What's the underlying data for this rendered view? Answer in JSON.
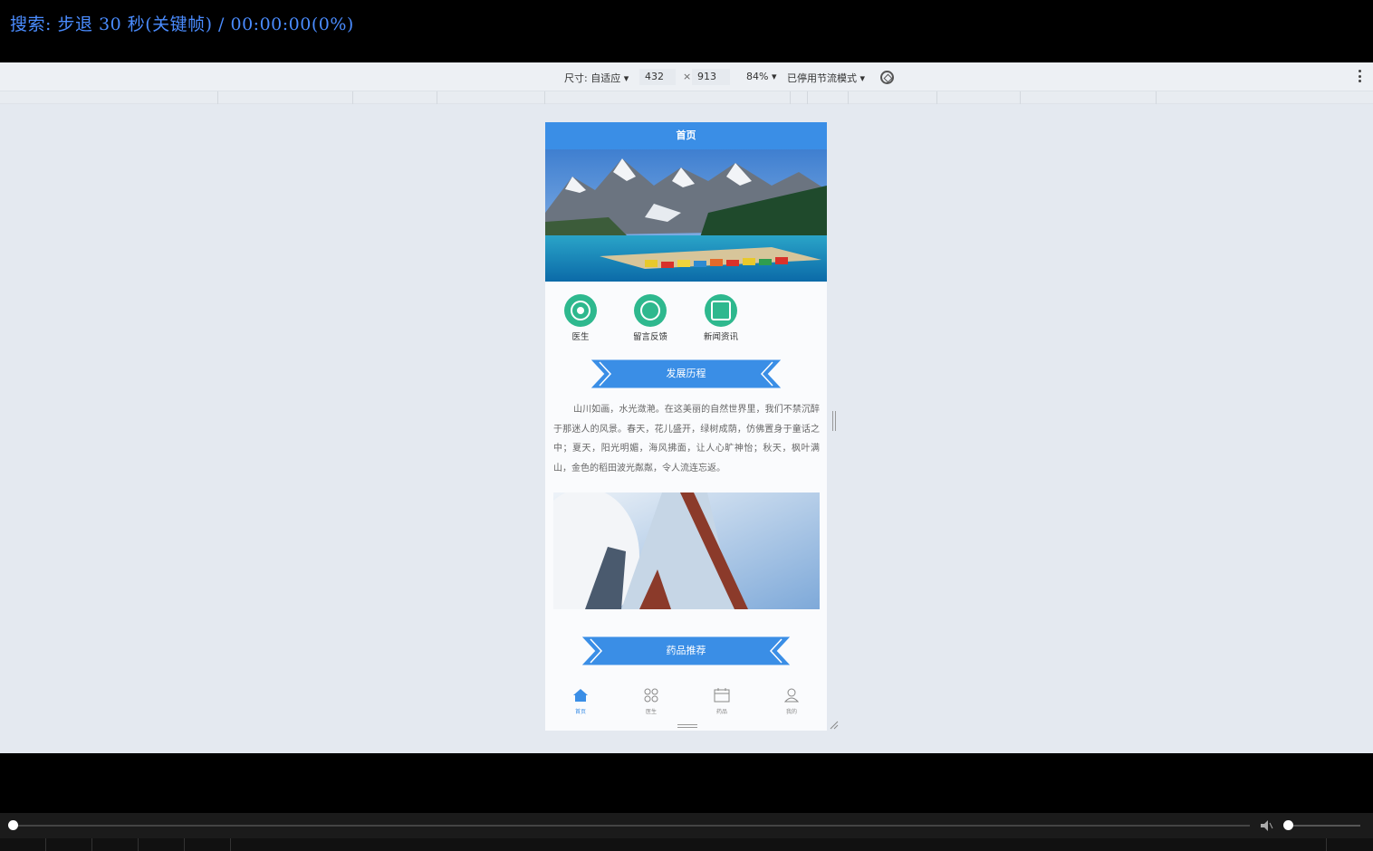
{
  "player": {
    "osd_text": "搜索: 步退 30 秒(关键帧) / 00:00:00(0%)"
  },
  "device_toolbar": {
    "size_label": "尺寸: 自适应 ▾",
    "width": "432",
    "times": "×",
    "height": "913",
    "zoom": "84% ▾",
    "throttle": "已停用节流模式 ▾",
    "rotate_icon": "rotate-icon",
    "more_icon": "more-vertical-icon"
  },
  "app": {
    "title": "首页",
    "banner_image": "mountain-lake-photo",
    "nav_items": [
      {
        "label": "医生",
        "icon": "doctor-icon"
      },
      {
        "label": "留言反馈",
        "icon": "feedback-icon"
      },
      {
        "label": "新闻资讯",
        "icon": "news-icon"
      }
    ],
    "section_history": "发展历程",
    "history_text": "山川如画，水光潋滟。在这美丽的自然世界里，我们不禁沉醉于那迷人的风景。春天，花儿盛开，绿树成荫，仿佛置身于童话之中；夏天，阳光明媚，海风拂面，让人心旷神怡；秋天，枫叶满山，金色的稻田波光粼粼，令人流连忘返。",
    "building_image": "glass-building-photo",
    "section_recommend": "药品推荐",
    "tabs": [
      {
        "label": "首页",
        "icon": "home-icon",
        "active": true
      },
      {
        "label": "医生",
        "icon": "grid-icon",
        "active": false
      },
      {
        "label": "药品",
        "icon": "calendar-icon",
        "active": false
      },
      {
        "label": "我的",
        "icon": "user-icon",
        "active": false
      }
    ],
    "accent_color": "#3a8ee6",
    "icon_color": "#2eb88e"
  },
  "seek": {
    "progress_percent": 0
  }
}
